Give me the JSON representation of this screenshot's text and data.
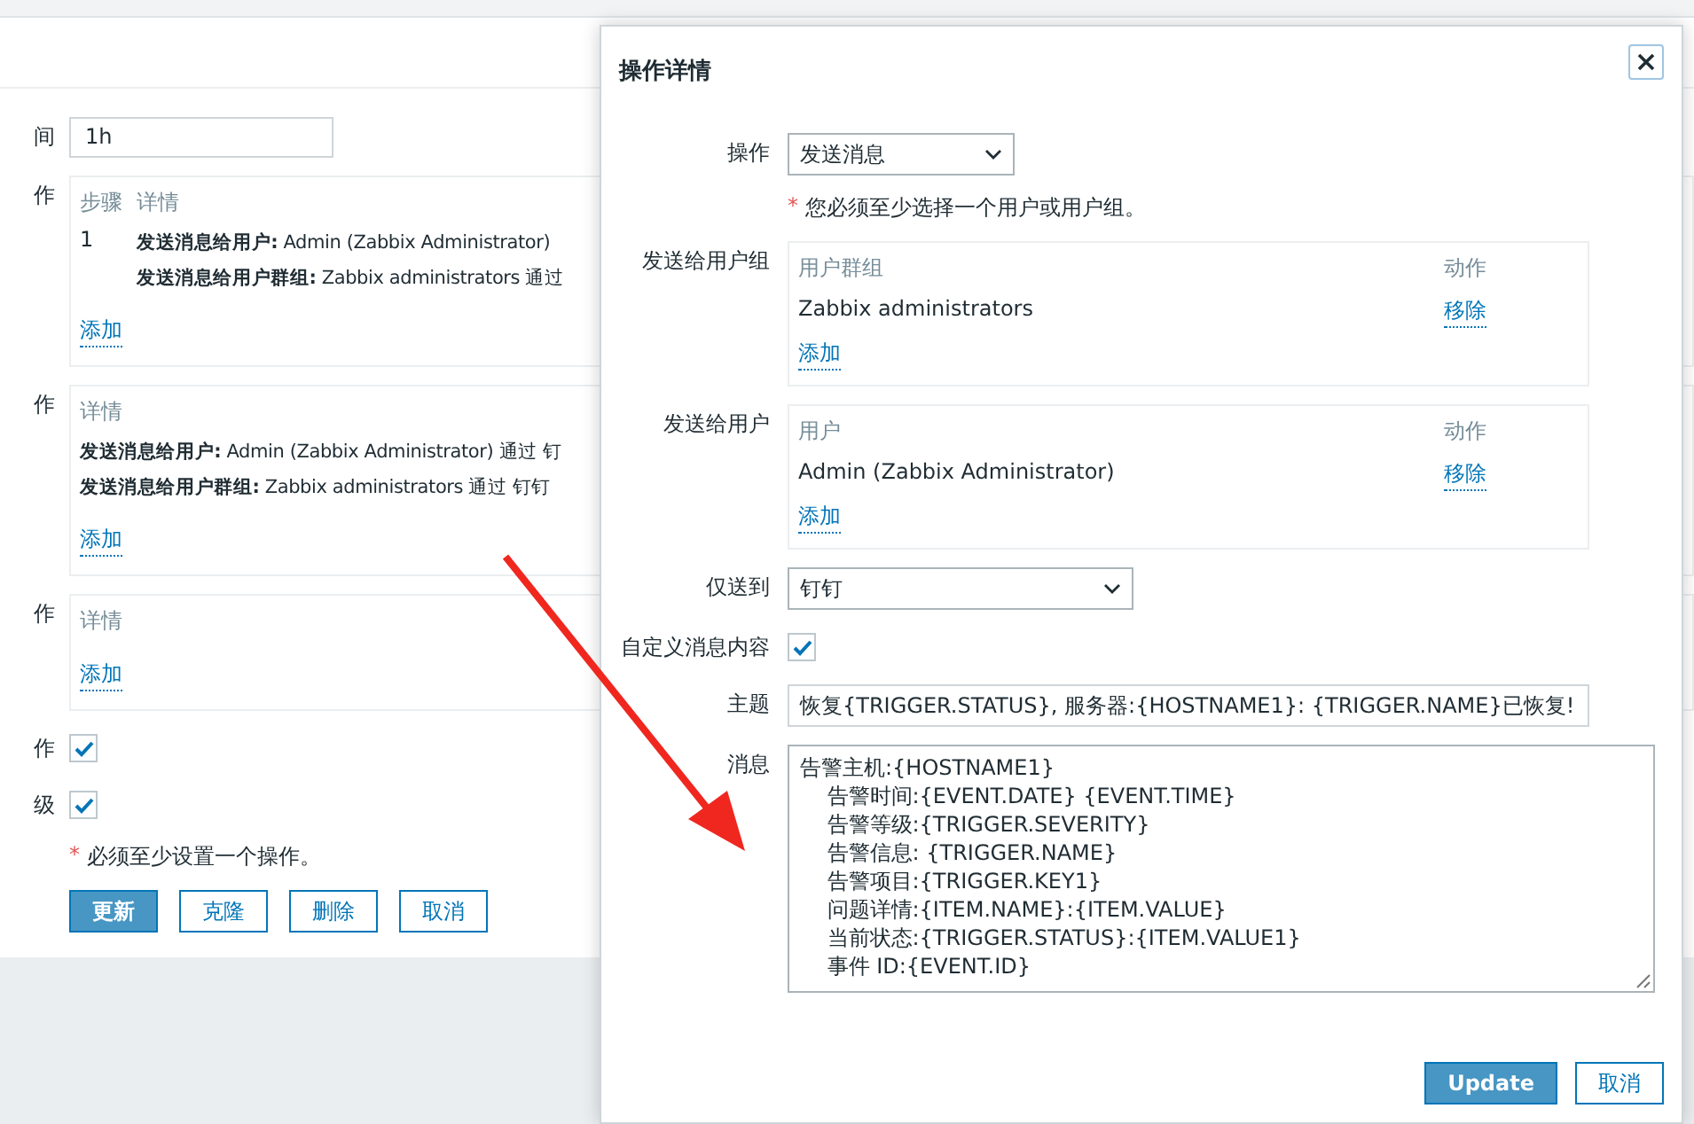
{
  "background": {
    "time": {
      "label": "间",
      "value": "1h"
    },
    "operations": {
      "label": "作",
      "columns": [
        "步骤",
        "详情"
      ],
      "rows": [
        {
          "step": "1",
          "details": [
            "**发送消息给用户:** Admin (Zabbix Administrator)",
            "**发送消息给用户群组:** Zabbix administrators 通过"
          ]
        }
      ],
      "add_link": "添加"
    },
    "recovery_operations": {
      "label": "作",
      "columns": [
        "详情"
      ],
      "rows": [
        {
          "details": [
            "**发送消息给用户:** Admin (Zabbix Administrator) 通过 钉",
            "**发送消息给用户群组:** Zabbix administrators 通过 钉钉"
          ]
        }
      ],
      "add_link": "添加"
    },
    "update_operations": {
      "label": "作",
      "columns": [
        "详情"
      ],
      "add_link": "添加"
    },
    "checkboxes": [
      {
        "label": "作",
        "checked": true
      },
      {
        "label": "级",
        "checked": true
      }
    ],
    "note": {
      "mark": "*",
      "text": "必须至少设置一个操作。"
    },
    "buttons": [
      {
        "label": "更新",
        "primary": true
      },
      {
        "label": "克隆",
        "primary": false
      },
      {
        "label": "删除",
        "primary": false
      },
      {
        "label": "取消",
        "primary": false
      }
    ]
  },
  "dialog": {
    "title": "操作详情",
    "operation": {
      "label": "操作",
      "value": "发送消息"
    },
    "note": {
      "mark": "*",
      "text": "您必须至少选择一个用户或用户组。"
    },
    "user_groups": {
      "label": "发送给用户组",
      "columns": [
        "用户群组",
        "动作"
      ],
      "rows": [
        {
          "name": "Zabbix administrators",
          "action": "移除"
        }
      ],
      "add_link": "添加"
    },
    "users": {
      "label": "发送给用户",
      "columns": [
        "用户",
        "动作"
      ],
      "rows": [
        {
          "name": "Admin (Zabbix Administrator)",
          "action": "移除"
        }
      ],
      "add_link": "添加"
    },
    "send_only_to": {
      "label": "仅送到",
      "value": "钉钉"
    },
    "custom_message": {
      "label": "自定义消息内容",
      "checked": true
    },
    "subject": {
      "label": "主题",
      "value": "恢复{TRIGGER.STATUS}, 服务器:{HOSTNAME1}: {TRIGGER.NAME}已恢复!"
    },
    "message": {
      "label": "消息",
      "value": "告警主机:{HOSTNAME1}\n    告警时间:{EVENT.DATE} {EVENT.TIME}\n    告警等级:{TRIGGER.SEVERITY}\n    告警信息: {TRIGGER.NAME}\n    告警项目:{TRIGGER.KEY1}\n    问题详情:{ITEM.NAME}:{ITEM.VALUE}\n    当前状态:{TRIGGER.STATUS}:{ITEM.VALUE1}\n    事件 ID:{EVENT.ID}"
    },
    "buttons": [
      {
        "label": "Update",
        "primary": true
      },
      {
        "label": "取消",
        "primary": false
      }
    ]
  }
}
